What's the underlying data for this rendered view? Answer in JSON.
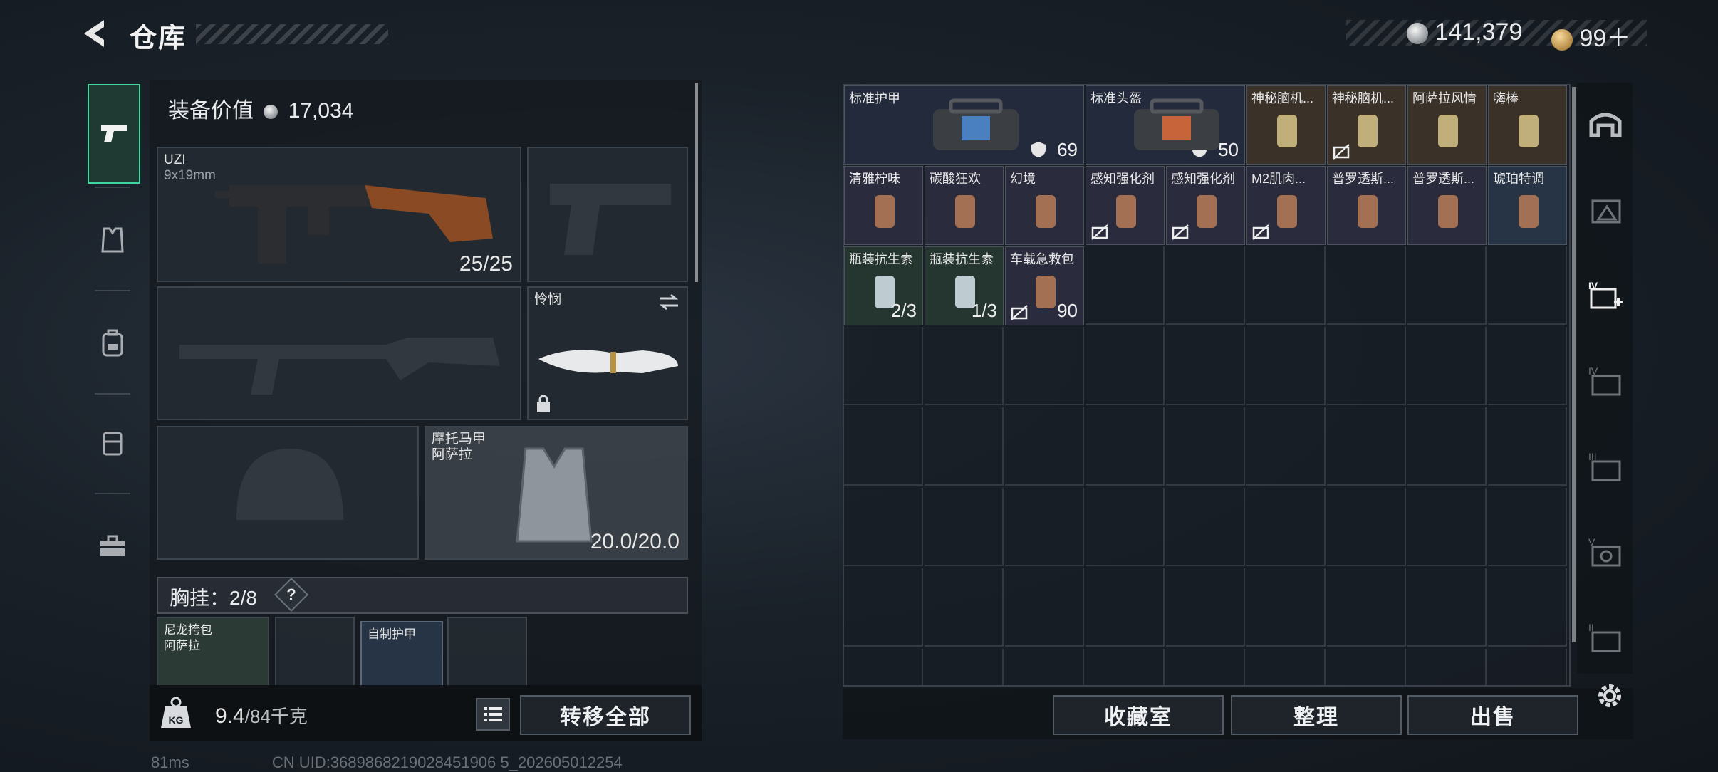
{
  "header": {
    "title": "仓库"
  },
  "currency": [
    {
      "type": "silver",
      "value": "141,379"
    },
    {
      "type": "gold",
      "value": "99＋"
    }
  ],
  "rail": {
    "tabs": [
      "pistol-icon",
      "vest-icon",
      "backpack-icon",
      "chest-rig-icon",
      "toolbox-icon"
    ],
    "active": 0
  },
  "loadout": {
    "equip_value_label": "装备价值",
    "equip_value": "17,034",
    "primary": {
      "name": "UZI",
      "caliber": "9x19mm",
      "ammo": "25/25"
    },
    "melee": {
      "name": "怜悯"
    },
    "armor": {
      "name": "摩托马甲",
      "sub": "阿萨拉",
      "durability": "20.0/20.0"
    },
    "chest_rig": {
      "label": "胸挂：2/8",
      "help": "?"
    },
    "rig_items": [
      {
        "name": "尼龙挎包",
        "sub": "阿萨拉"
      },
      {
        "name": "自制护甲"
      }
    ]
  },
  "bottom": {
    "weight": "9.4",
    "weight_max": "/84千克",
    "transfer_all": "转移全部",
    "collection": "收藏室",
    "organize": "整理",
    "sell": "出售"
  },
  "storage": {
    "items": [
      {
        "name": "标准护甲",
        "value": "69",
        "icon": "armor-shield-icon",
        "bg": "std"
      },
      {
        "name": "标准头盔",
        "value": "50",
        "icon": "armor-shield-icon",
        "bg": "std"
      },
      {
        "name": "神秘脑机...",
        "value": "",
        "bg": "gold"
      },
      {
        "name": "神秘脑机...",
        "value": "",
        "bg": "gold"
      },
      {
        "name": "阿萨拉风情",
        "value": "",
        "bg": "gold"
      },
      {
        "name": "嗨棒",
        "value": "",
        "bg": "gold"
      },
      {
        "name": "清雅柠味",
        "value": "",
        "bg": "purple"
      },
      {
        "name": "碳酸狂欢",
        "value": "",
        "bg": "purple"
      },
      {
        "name": "幻境",
        "value": "",
        "bg": "purple"
      },
      {
        "name": "感知强化剂",
        "value": "",
        "bg": "purple"
      },
      {
        "name": "感知强化剂",
        "value": "",
        "bg": "purple"
      },
      {
        "name": "M2肌肉...",
        "value": "",
        "bg": "purple"
      },
      {
        "name": "普罗透斯...",
        "value": "",
        "bg": "purple"
      },
      {
        "name": "普罗透斯...",
        "value": "",
        "bg": "purple"
      },
      {
        "name": "琥珀特调",
        "value": "",
        "bg": "blue"
      },
      {
        "name": "瓶装抗生素",
        "value": "2/3",
        "bg": "green"
      },
      {
        "name": "瓶装抗生素",
        "value": "1/3",
        "bg": "green"
      },
      {
        "name": "车载急救包",
        "value": "90",
        "bg": "purple"
      }
    ]
  },
  "footer": {
    "ping": "81ms",
    "uid": "CN UID:3689868219028451906 5_202605012254"
  },
  "colors": {
    "accent": "#3fd7a0",
    "gold_bg": "#3a3128",
    "purple_bg": "#2a2b3c",
    "green_bg": "#24362f"
  }
}
